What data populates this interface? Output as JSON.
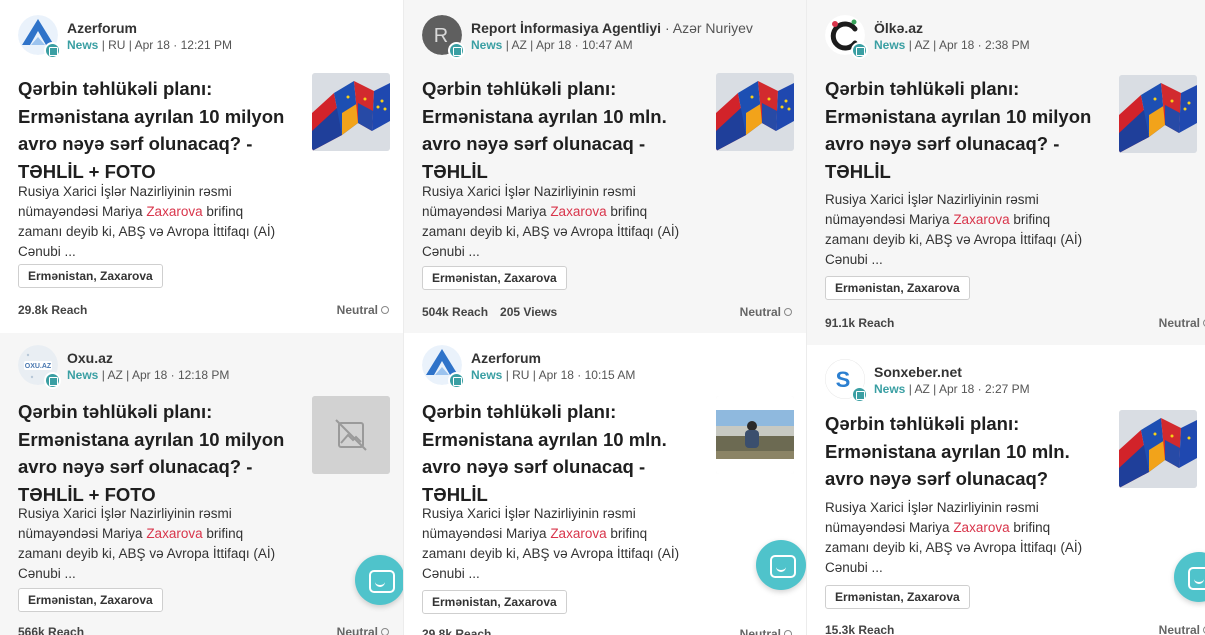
{
  "cards": [
    {
      "source": "Azerforum",
      "author": "",
      "meta_label": "News",
      "meta_rest": " | RU | Apr 18 · 12:21 PM",
      "logo": "azerforum-logo",
      "title": "Qərbin təhlükəli planı: Ermənistana ayrılan 10 milyon avro nəyə sərf olunacaq? - TƏHLİL + FOTO",
      "snippet_pre": "Rusiya Xarici İşlər Nazirliyinin rəsmi nümayəndəsi Mariya ",
      "snippet_hl": "Zaxarova",
      "snippet_post": " brifinq zamanı deyib ki, ABŞ və Avropa İttifaqı (Aİ) Cənubi ...",
      "tags": "Ermənistan, Zaxarova",
      "reach": "29.8k Reach",
      "views": "",
      "sentiment": "Neutral",
      "thumbnail": "flags-image"
    },
    {
      "source": "Report İnformasiya Agentliyi",
      "author": " · Azər Nuriyev",
      "meta_label": "News",
      "meta_rest": " | AZ | Apr 18 · 10:47 AM",
      "logo": "report-logo",
      "title": "Qərbin təhlükəli planı: Ermənistana ayrılan 10 mln. avro nəyə sərf olunacaq - TƏHLİL",
      "snippet_pre": "Rusiya Xarici İşlər Nazirliyinin rəsmi nümayəndəsi Mariya ",
      "snippet_hl": "Zaxarova",
      "snippet_post": " brifinq zamanı deyib ki, ABŞ və Avropa İttifaqı (Aİ) Cənubi ...",
      "tags": "Ermənistan, Zaxarova",
      "reach": "504k Reach",
      "views": "205 Views",
      "sentiment": "Neutral",
      "thumbnail": "flags-image"
    },
    {
      "source": "Ölkə.az",
      "author": "",
      "meta_label": "News",
      "meta_rest": " | AZ | Apr 18 · 2:38 PM",
      "logo": "olke-logo",
      "title": "Qərbin təhlükəli planı: Ermənistana ayrılan 10 milyon avro nəyə sərf olunacaq? - TƏHLİL",
      "snippet_pre": "Rusiya Xarici İşlər Nazirliyinin rəsmi nümayəndəsi Mariya ",
      "snippet_hl": "Zaxarova",
      "snippet_post": " brifinq zamanı deyib ki, ABŞ və Avropa İttifaqı (Aİ) Cənubi ...",
      "tags": "Ermənistan, Zaxarova",
      "reach": "91.1k Reach",
      "views": "",
      "sentiment": "Neutral",
      "thumbnail": "flags-image"
    },
    {
      "source": "Oxu.az",
      "author": "",
      "meta_label": "News",
      "meta_rest": " | AZ | Apr 18 · 12:18 PM",
      "logo": "oxu-logo",
      "title": "Qərbin təhlükəli planı: Ermənistana ayrılan 10 milyon avro nəyə sərf olunacaq? - TƏHLİL + FOTO",
      "snippet_pre": "Rusiya Xarici İşlər Nazirliyinin rəsmi nümayəndəsi Mariya ",
      "snippet_hl": "Zaxarova",
      "snippet_post": " brifinq zamanı deyib ki, ABŞ və Avropa İttifaqı (Aİ) Cənubi ...",
      "tags": "Ermənistan, Zaxarova",
      "reach": "566k Reach",
      "views": "",
      "sentiment": "Neutral",
      "thumbnail": "image-unavailable-icon"
    },
    {
      "source": "Azerforum",
      "author": "",
      "meta_label": "News",
      "meta_rest": " | RU | Apr 18 · 10:15 AM",
      "logo": "azerforum-logo",
      "title": "Qərbin təhlükəli planı: Ermənistana ayrılan 10 mln. avro nəyə sərf olunacaq - TƏHLİL",
      "snippet_pre": "Rusiya Xarici İşlər Nazirliyinin rəsmi nümayəndəsi Mariya ",
      "snippet_hl": "Zaxarova",
      "snippet_post": " brifinq zamanı deyib ki, ABŞ və Avropa İttifaqı (Aİ) Cənubi ...",
      "tags": "Ermənistan, Zaxarova",
      "reach": "29.8k Reach",
      "views": "",
      "sentiment": "Neutral",
      "thumbnail": "landscape-photo"
    },
    {
      "source": "Sonxeber.net",
      "author": "",
      "meta_label": "News",
      "meta_rest": " | AZ | Apr 18 · 2:27 PM",
      "logo": "sonxeber-logo",
      "title": "Qərbin təhlükəli planı: Ermənistana ayrılan 10 mln. avro nəyə sərf olunacaq?",
      "snippet_pre": "Rusiya Xarici İşlər Nazirliyinin rəsmi nümayəndəsi Mariya ",
      "snippet_hl": "Zaxarova",
      "snippet_post": " brifinq zamanı deyib ki, ABŞ və Avropa İttifaqı (Aİ) Cənubi ...",
      "tags": "Ermənistan, Zaxarova",
      "reach": "15.3k Reach",
      "views": "",
      "sentiment": "Neutral",
      "thumbnail": "flags-image"
    }
  ],
  "colors": {
    "accent": "#3a9fa3",
    "highlight": "#d8344a",
    "chat_button": "#4fc3cb",
    "card_shade": "#f6f6f6"
  },
  "chat_button_icon": "chat-icon"
}
